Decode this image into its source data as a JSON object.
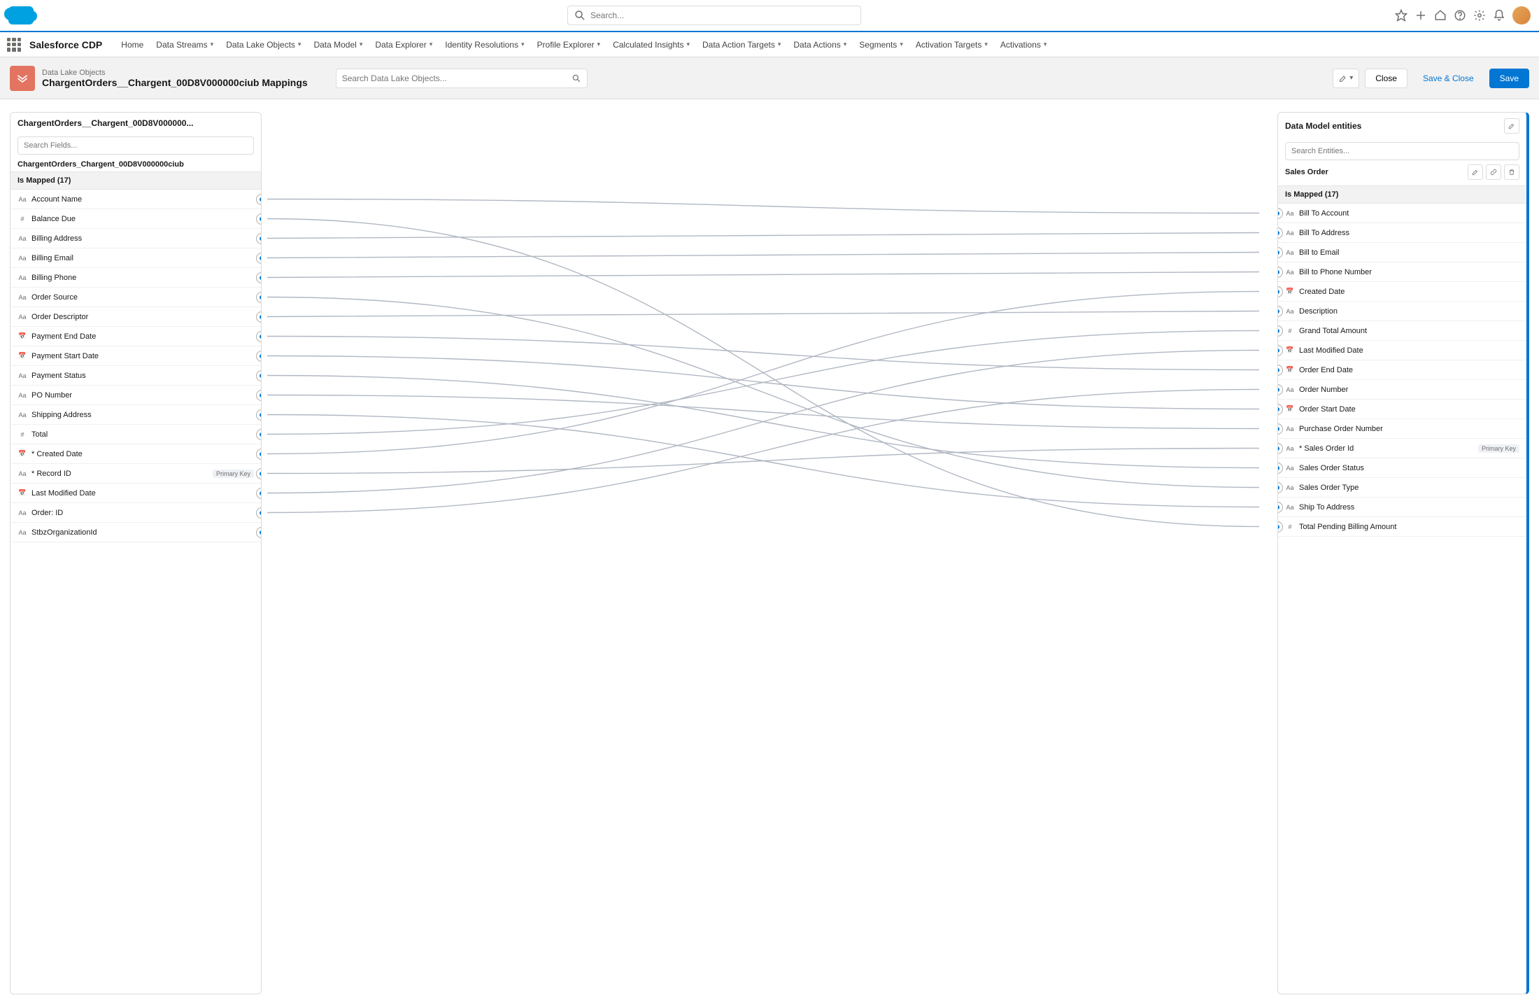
{
  "header": {
    "search_placeholder": "Search...",
    "app_name": "Salesforce CDP",
    "nav": [
      "Home",
      "Data Streams",
      "Data Lake Objects",
      "Data Model",
      "Data Explorer",
      "Identity Resolutions",
      "Profile Explorer",
      "Calculated Insights",
      "Data Action Targets",
      "Data Actions",
      "Segments",
      "Activation Targets",
      "Activations"
    ]
  },
  "page": {
    "object_type": "Data Lake Objects",
    "title": "ChargentOrders__Chargent_00D8V000000ciub Mappings",
    "dlo_search_placeholder": "Search Data Lake Objects...",
    "buttons": {
      "new_mapping": "+",
      "close": "Close",
      "save_close": "Save & Close",
      "save": "Save"
    }
  },
  "left_panel": {
    "title": "ChargentOrders__Chargent_00D8V000000...",
    "search_placeholder": "Search Fields...",
    "subtitle": "ChargentOrders_Chargent_00D8V000000ciub",
    "mapped_header": "Is Mapped (17)",
    "fields": [
      {
        "name": "Account Name",
        "type": "Aa"
      },
      {
        "name": "Balance Due",
        "type": "#"
      },
      {
        "name": "Billing Address",
        "type": "Aa"
      },
      {
        "name": "Billing Email",
        "type": "Aa"
      },
      {
        "name": "Billing Phone",
        "type": "Aa"
      },
      {
        "name": "Order Source",
        "type": "Aa"
      },
      {
        "name": "Order Descriptor",
        "type": "Aa"
      },
      {
        "name": "Payment End Date",
        "type": "📅"
      },
      {
        "name": "Payment Start Date",
        "type": "📅"
      },
      {
        "name": "Payment Status",
        "type": "Aa"
      },
      {
        "name": "PO Number",
        "type": "Aa"
      },
      {
        "name": "Shipping Address",
        "type": "Aa"
      },
      {
        "name": "Total",
        "type": "#"
      },
      {
        "name": "* Created Date",
        "type": "📅"
      },
      {
        "name": "* Record ID",
        "type": "Aa",
        "badge": "Primary Key"
      },
      {
        "name": "Last Modified Date",
        "type": "📅"
      },
      {
        "name": "Order: ID",
        "type": "Aa"
      },
      {
        "name": "StbzOrganizationId",
        "type": "Aa"
      }
    ]
  },
  "right_panel": {
    "title": "Data Model entities",
    "search_placeholder": "Search Entities...",
    "subtitle": "Sales Order",
    "mapped_header": "Is Mapped (17)",
    "fields": [
      {
        "name": "Bill To Account",
        "type": "Aa"
      },
      {
        "name": "Bill To Address",
        "type": "Aa"
      },
      {
        "name": "Bill to Email",
        "type": "Aa"
      },
      {
        "name": "Bill to Phone Number",
        "type": "Aa"
      },
      {
        "name": "Created Date",
        "type": "📅"
      },
      {
        "name": "Description",
        "type": "Aa"
      },
      {
        "name": "Grand Total Amount",
        "type": "#"
      },
      {
        "name": "Last Modified Date",
        "type": "📅"
      },
      {
        "name": "Order End Date",
        "type": "📅"
      },
      {
        "name": "Order Number",
        "type": "Aa"
      },
      {
        "name": "Order Start Date",
        "type": "📅"
      },
      {
        "name": "Purchase Order Number",
        "type": "Aa"
      },
      {
        "name": "* Sales Order Id",
        "type": "Aa",
        "badge": "Primary Key"
      },
      {
        "name": "Sales Order Status",
        "type": "Aa"
      },
      {
        "name": "Sales Order Type",
        "type": "Aa"
      },
      {
        "name": "Ship To Address",
        "type": "Aa"
      },
      {
        "name": "Total Pending Billing Amount",
        "type": "#"
      }
    ]
  },
  "mappings": [
    [
      0,
      0
    ],
    [
      1,
      16
    ],
    [
      2,
      1
    ],
    [
      3,
      2
    ],
    [
      4,
      3
    ],
    [
      5,
      14
    ],
    [
      6,
      5
    ],
    [
      7,
      8
    ],
    [
      8,
      10
    ],
    [
      9,
      13
    ],
    [
      10,
      11
    ],
    [
      11,
      15
    ],
    [
      12,
      6
    ],
    [
      13,
      4
    ],
    [
      14,
      12
    ],
    [
      15,
      7
    ],
    [
      16,
      9
    ]
  ]
}
